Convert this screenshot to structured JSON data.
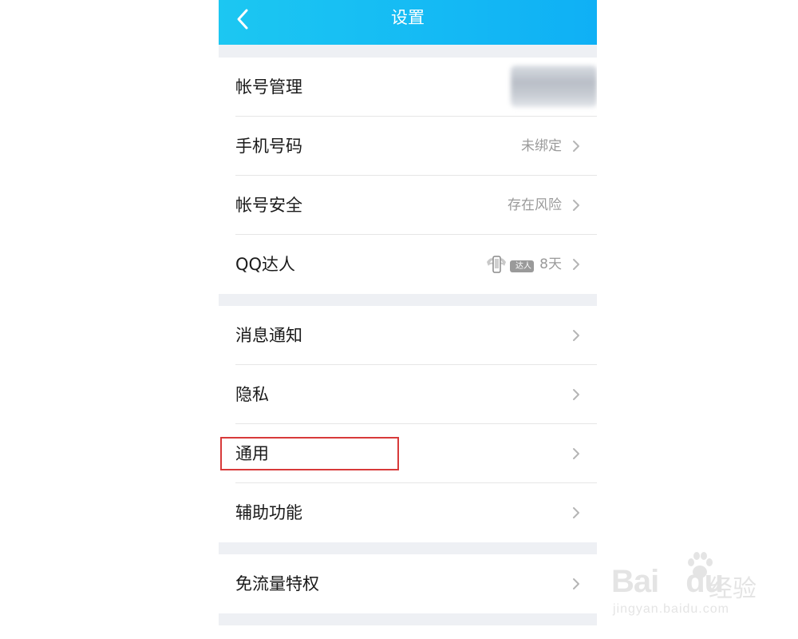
{
  "header": {
    "title": "设置",
    "back_icon": "chevron-left-icon"
  },
  "groups": [
    {
      "items": [
        {
          "label": "帐号管理",
          "value": "",
          "has_chevron": false
        },
        {
          "label": "手机号码",
          "value": "未绑定",
          "has_chevron": true
        },
        {
          "label": "帐号安全",
          "value": "存在风险",
          "has_chevron": true
        },
        {
          "label": "QQ达人",
          "value": "8天",
          "badge_text": "达人",
          "has_chevron": true
        }
      ]
    },
    {
      "items": [
        {
          "label": "消息通知",
          "value": "",
          "has_chevron": true
        },
        {
          "label": "隐私",
          "value": "",
          "has_chevron": true
        },
        {
          "label": "通用",
          "value": "",
          "has_chevron": true
        },
        {
          "label": "辅助功能",
          "value": "",
          "has_chevron": true
        }
      ]
    },
    {
      "items": [
        {
          "label": "免流量特权",
          "value": "",
          "has_chevron": true
        }
      ]
    }
  ],
  "watermark": {
    "brand": "Bai",
    "brand2": "du",
    "cn": "经验",
    "url": "jingyan.baidu.com"
  },
  "colors": {
    "header_start": "#1cc7f2",
    "header_end": "#0fb0f5",
    "highlight": "#d83a3a"
  }
}
